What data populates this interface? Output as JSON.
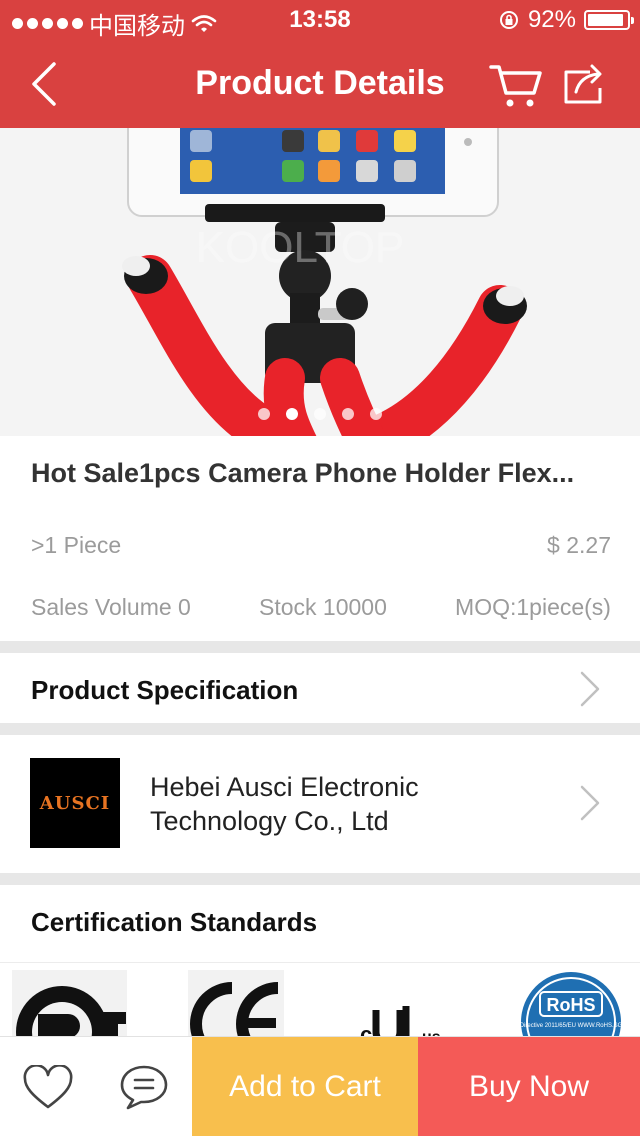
{
  "status_bar": {
    "carrier": "中国移动",
    "time": "13:58",
    "battery": "92%",
    "battery_level": 0.92
  },
  "header": {
    "title": "Product Details",
    "back_icon": "chevron-left-icon",
    "cart_icon": "shopping-cart-icon",
    "share_icon": "share-icon"
  },
  "product": {
    "watermark": "KOOLTOP",
    "image_dots": 5,
    "active_dot": 1,
    "title": "Hot Sale1pcs Camera Phone Holder Flex...",
    "min_order_label": ">1 Piece",
    "price": "$ 2.27",
    "sales_volume": "Sales Volume 0",
    "stock": "Stock 10000",
    "moq": "MOQ:1piece(s)"
  },
  "specification": {
    "title": "Product Specification"
  },
  "supplier": {
    "logo_text": "AUSCI",
    "name": "Hebei Ausci Electronic Technology Co., Ltd"
  },
  "certifications": {
    "title": "Certification Standards",
    "items": [
      "PCT",
      "CE",
      "UL",
      "RoHS"
    ],
    "rohs_label": "RoHS",
    "rohs_subtext": "Directive 2011/65/EU WWW.RoHS.SG"
  },
  "bottom_bar": {
    "favorite_icon": "heart-icon",
    "message_icon": "chat-icon",
    "add_to_cart": "Add to Cart",
    "buy_now": "Buy Now"
  },
  "colors": {
    "header": "#d94140",
    "add_to_cart": "#f8bf4d",
    "buy_now": "#f45a57",
    "separator": "#e7e7e7"
  }
}
